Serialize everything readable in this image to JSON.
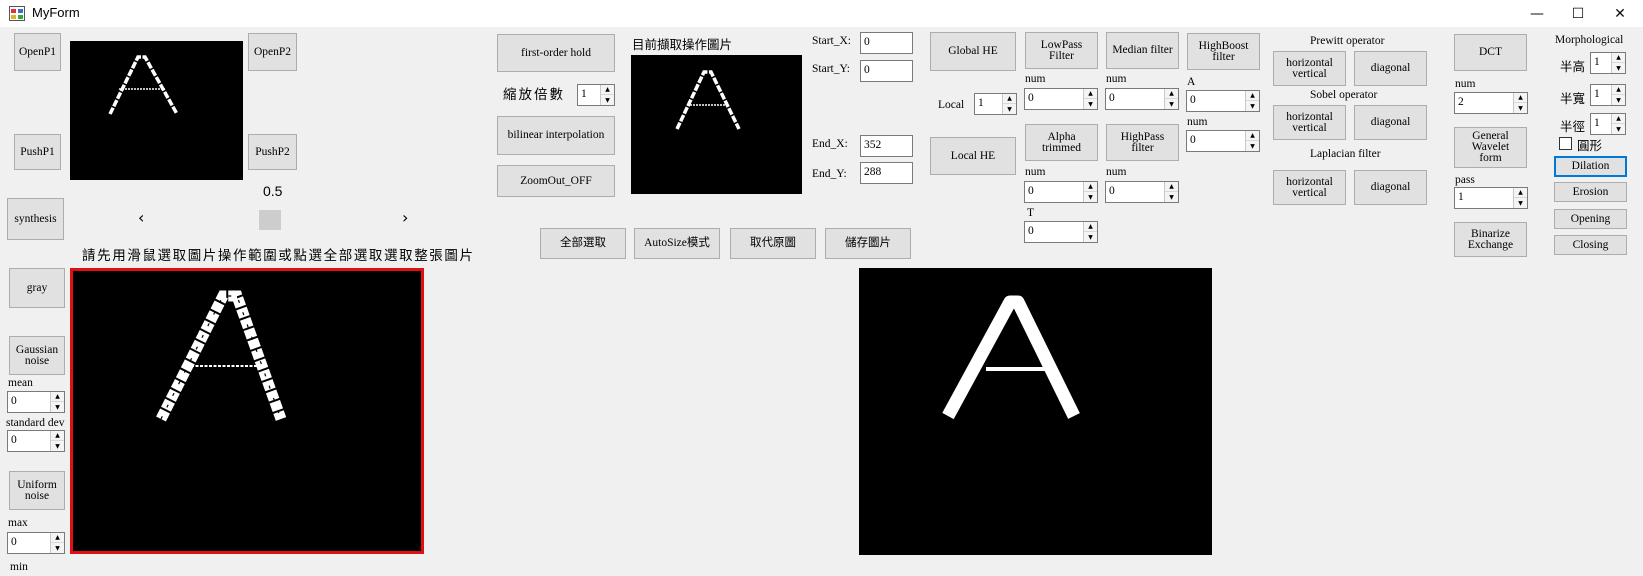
{
  "window": {
    "title": "MyForm",
    "minimize_glyph": "—",
    "maximize_glyph": "☐",
    "close_glyph": "✕"
  },
  "left": {
    "open_p1": "OpenP1",
    "open_p2": "OpenP2",
    "push_p1": "PushP1",
    "push_p2": "PushP2",
    "synthesis": "synthesis",
    "gray": "gray",
    "gaussian_noise": "Gaussian\nnoise",
    "mean_label": "mean",
    "mean_value": "0",
    "std_label": "standard dev",
    "std_value": "0",
    "uniform_noise": "Uniform\nnoise",
    "max_label": "max",
    "max_value": "0",
    "min_label": "min"
  },
  "slider": {
    "value_text": "0.5",
    "left_arrow": "‹",
    "right_arrow": "›",
    "position_fraction": 0.5
  },
  "instruction": "請先用滑鼠選取圖片操作範圍或點選全部選取選取整張圖片",
  "zoom": {
    "first_order_hold": "first-order hold",
    "scale_label": "縮放倍數",
    "scale_value": "1",
    "bilinear": "bilinear interpolation",
    "zoomout": "ZoomOut_OFF"
  },
  "current_pic_label": "目前擷取操作圖片",
  "coords": {
    "start_x_label": "Start_X:",
    "start_x": "0",
    "start_y_label": "Start_Y:",
    "start_y": "0",
    "end_x_label": "End_X:",
    "end_x": "352",
    "end_y_label": "End_Y:",
    "end_y": "288"
  },
  "actions": {
    "select_all": "全部選取",
    "autosize": "AutoSize模式",
    "replace": "取代原圖",
    "save": "儲存圖片"
  },
  "he": {
    "global": "Global HE",
    "local_label": "Local",
    "local_value": "1",
    "local_he": "Local HE"
  },
  "filters": {
    "lowpass": "LowPass\nFilter",
    "median": "Median filter",
    "highboost": "HighBoost\nfilter",
    "num_label": "num",
    "lowpass_num": "0",
    "median_num": "0",
    "a_label": "A",
    "a_value": "0",
    "hb_num_label": "num",
    "hb_num": "0",
    "alpha": "Alpha\ntrimmed",
    "highpass": "HighPass\nfilter",
    "alpha_num": "0",
    "highpass_num": "0",
    "t_label": "T",
    "t_value": "0"
  },
  "edges": {
    "prewitt": "Prewitt operator",
    "sobel": "Sobel operator",
    "laplacian": "Laplacian filter",
    "hv": "horizontal\nvertical",
    "diagonal": "diagonal"
  },
  "transform": {
    "dct": "DCT",
    "num_label": "num",
    "num_value": "2",
    "wavelet": "General\nWavelet\nform",
    "pass_label": "pass",
    "pass_value": "1",
    "binarize": "Binarize\nExchange"
  },
  "morph": {
    "title": "Morphological",
    "height_label": "半高",
    "height_value": "1",
    "width_label": "半寬",
    "width_value": "1",
    "radius_label": "半徑",
    "radius_value": "1",
    "circle_label": "圓形",
    "dilation": "Dilation",
    "erosion": "Erosion",
    "opening": "Opening",
    "closing": "Closing"
  },
  "glyphs": {
    "up": "▲",
    "down": "▼"
  }
}
